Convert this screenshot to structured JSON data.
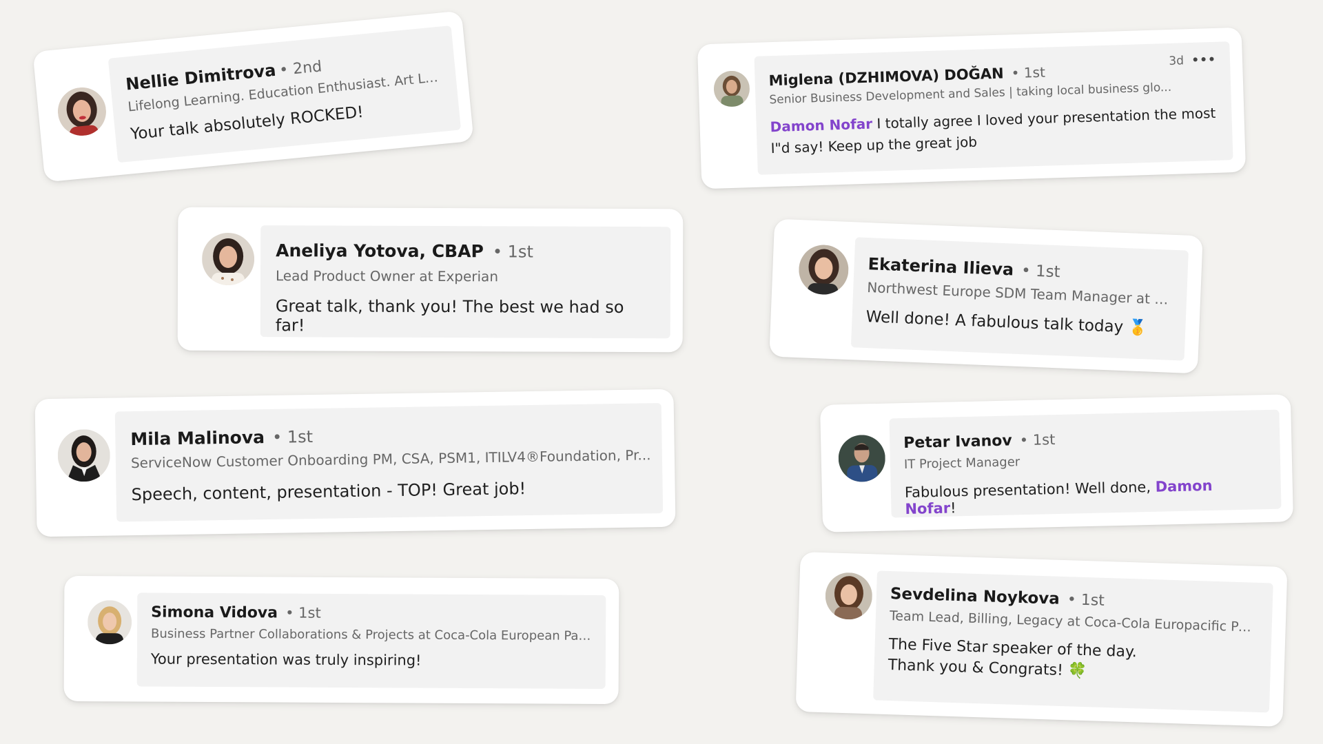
{
  "comments": [
    {
      "name": "Nellie Dimitrova",
      "degree": "• 2nd",
      "headline": "Lifelong Learning. Education Enthusiast. Art Lover.",
      "text": "Your talk absolutely ROCKED!"
    },
    {
      "name": "Miglena (DZHIMOVA) DOĞAN",
      "degree": "• 1st",
      "headline": "Senior Business Development and Sales | taking local business glo...",
      "mention": "Damon Nofar",
      "text": " I totally agree I loved your presentation the most I\"d say! Keep up the great job",
      "time": "3d",
      "more": "•••"
    },
    {
      "name": "Aneliya Yotova, CBAP",
      "degree": "• 1st",
      "headline": "Lead Product Owner at Experian",
      "text": "Great talk, thank you! The best we had so far!"
    },
    {
      "name": "Ekaterina Ilieva",
      "degree": "• 1st",
      "headline": "Northwest Europe SDM Team Manager at HP",
      "text": "Well done! A fabulous talk today",
      "emoji": "🥇"
    },
    {
      "name": "Mila Malinova",
      "degree": "• 1st",
      "headline": "ServiceNow Customer Onboarding PM, CSA, PSM1, ITILV4®Foundation, Pr...",
      "text": "Speech, content, presentation - TOP! Great job!"
    },
    {
      "name": "Petar Ivanov",
      "degree": "• 1st",
      "headline": "IT Project Manager",
      "text": "Fabulous presentation! Well done, ",
      "mention": "Damon Nofar",
      "text_end": "!"
    },
    {
      "name": "Simona Vidova",
      "degree": "• 1st",
      "headline": "Business Partner Collaborations & Projects at Coca-Cola European Partners",
      "text": "Your presentation was truly inspiring!"
    },
    {
      "name": "Sevdelina Noykova",
      "degree": "• 1st",
      "headline": "Team Lead, Billing, Legacy at Coca-Cola Europacific Partners",
      "text_line1": "The Five Star speaker of the day.",
      "text_line2": "Thank you & Congrats!",
      "emoji": "🍀"
    }
  ],
  "colors": {
    "background": "#f3f2ef",
    "card": "#ffffff",
    "bubble": "#f2f2f2",
    "mention": "#8344cc",
    "secondary_text": "#666666"
  }
}
